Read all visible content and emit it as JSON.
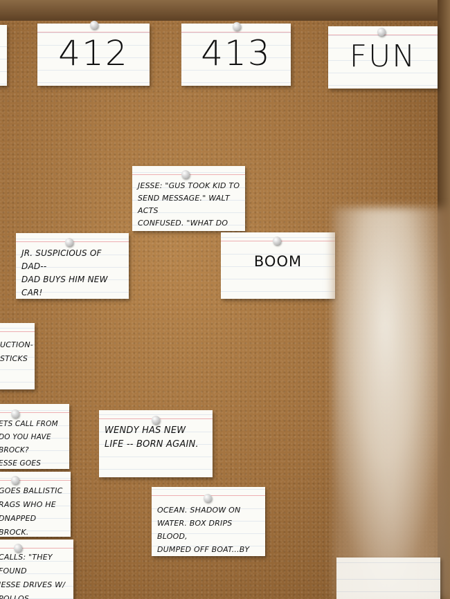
{
  "board": {
    "header_cards": [
      "412",
      "413",
      "FUN"
    ],
    "cards": {
      "jesse": "JESSE: \"GUS TOOK KID TO\nSEND MESSAGE.\" WALT ACTS\nCONFUSED. \"WHAT DO WE DO?\"",
      "jr": "JR. SUSPICIOUS OF DAD--\nDAD BUYS HIM NEW CAR!\nJR. CHAFES AT GIFT.",
      "boom": "BOOM",
      "uction": "UCTION-\nSTICKS",
      "etscall": "ETS CALL FROM\nDO YOU HAVE BROCK?\nESSE GOES NUTS.",
      "wendy": "WENDY HAS NEW\nLIFE -- BORN AGAIN.",
      "goes": "GOES BALLISTIC\nRAGS WHO HE\nDNAPPED BROCK.",
      "ocean": "OCEAN. SHADOW ON\nWATER. BOX DRIPS BLOOD,\nDUMPED OFF BOAT...BY WALT.",
      "calls": "CALLS: \"THEY FOUND\nJESSE DRIVES w/\nPOLLOS HERMANOS?"
    }
  },
  "colors": {
    "cork": "#9f6f3c",
    "frame": "#6f5030",
    "card": "#fbfbf7"
  }
}
